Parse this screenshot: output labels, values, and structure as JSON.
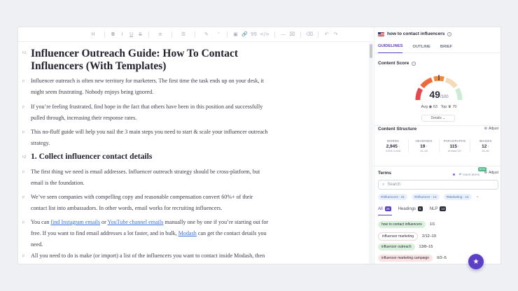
{
  "toolbar": {
    "items": [
      "H",
      "B",
      "I",
      "U",
      "S",
      "≡",
      "☰",
      "✎",
      "⁼",
      "▣",
      "🔗",
      "99",
      "</>",
      "—",
      "⌧",
      "⌫",
      "↶",
      "↷"
    ]
  },
  "editor": {
    "title": "Influencer Outreach Guide: How To Contact Influencers (With Templates)",
    "title_tag": "h1",
    "p_tag": "p",
    "h2_tag": "h2",
    "paragraphs": [
      "Influencer outreach is often new territory for marketers. The first time the task ends up on your desk, it might seem frustrating. Nobody enjoys being ignored.",
      "If you’re feeling frustrated, find hope in the fact that others have been in this position and successfully pulled through, increasing their response rates.",
      "This no-fluff guide will help you nail the 3 main steps you need to start & scale your influencer outreach strategy."
    ],
    "h2": "1. Collect influencer contact details",
    "paragraphs2": [
      "The first thing we need is email addresses. Influencer outreach strategy should be cross-platform, but email is the foundation.",
      "We’ve seen companies with compelling copy and reasonable compensation convert 60%+ of their contact list into ambassadors. In other words, email works for recruiting influencers."
    ],
    "p_links": {
      "t1": "You can ",
      "l1": "find Instagram emails",
      "t2": " or ",
      "l2": "YouTube channel emails",
      "t3": " manually one by one if you’re starting out for free. If you want to find email addresses a lot faster, and in bulk, ",
      "l3": "Modash",
      "t4": " can get the contact details you need."
    },
    "last": "All you need to do is make (or import) a list of the influencers you want to contact inside Modash, then hit ‘Export Contact Details’. If emails are publicly available anywhere, you’ll get"
  },
  "panel": {
    "keyword": "how to contact influencers",
    "tabs": [
      "GUIDELINES",
      "OUTLINE",
      "BRIEF"
    ],
    "content_score_label": "Content Score",
    "score": "49",
    "score_max": "/100",
    "avg": "Avg",
    "avg_val": "63",
    "top": "Top",
    "top_val": "70",
    "details": "Details",
    "structure_label": "Content Structure",
    "adjust": "Adjust",
    "stats": [
      {
        "label": "WORDS",
        "value": "2,945",
        "arrow": "↑",
        "range": "3,004–5,618"
      },
      {
        "label": "HEADINGS",
        "value": "19",
        "arrow": "↑",
        "range": "31–46"
      },
      {
        "label": "PARAGRAPHS",
        "value": "115",
        "arrow": "↑",
        "range": "at least 137"
      },
      {
        "label": "IMAGES",
        "value": "12",
        "arrow": "↑",
        "range": "28–80"
      }
    ],
    "terms_label": "Terms",
    "insert_terms": "Insert terms",
    "new_badge": "NEW",
    "search_placeholder": "Search",
    "chips": [
      "#influencers - 21",
      "#influencer - 14",
      "#Marketing - 12"
    ],
    "filter_tabs": [
      {
        "label": "All",
        "count": "28"
      },
      {
        "label": "Headings",
        "count": "5"
      },
      {
        "label": "NLP",
        "count": "14"
      }
    ],
    "terms": [
      {
        "term": "how to contact influencers",
        "count": "1/1",
        "state": "g"
      },
      {
        "term": "influencer marketing",
        "count": "2/12–19",
        "state": "w"
      },
      {
        "term": "influencer outreach",
        "count": "13/8–15",
        "state": "g"
      },
      {
        "term": "influencer marketing campaign",
        "count": "0/2–5",
        "state": "p"
      }
    ]
  },
  "colors": {
    "accent": "#5a3fbf",
    "gauge_red": "#e5484d",
    "gauge_orange": "#f0883e",
    "gauge_green": "#9fd8b0"
  }
}
